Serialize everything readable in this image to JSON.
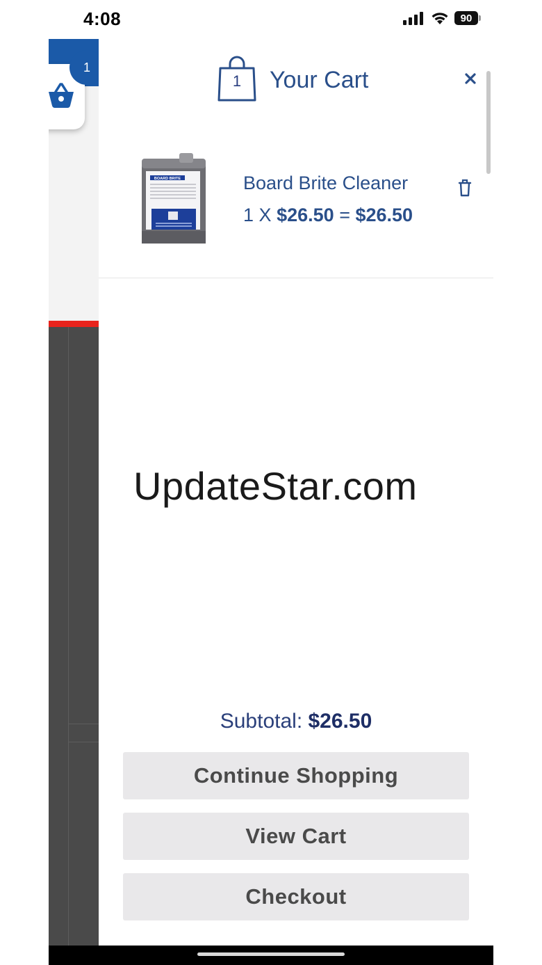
{
  "status_bar": {
    "time": "4:08",
    "battery": "90",
    "icons": [
      "cellular-signal-icon",
      "wifi-icon",
      "battery-icon"
    ]
  },
  "background_page": {
    "cart_badge": "1"
  },
  "cart": {
    "title": "Your Cart",
    "count": "1",
    "items": [
      {
        "name": "Board Brite Cleaner",
        "quantity": "1",
        "times": "X",
        "unit_price": "$26.50",
        "equals": "=",
        "line_total": "$26.50",
        "image_label": "BOARD BRITE"
      }
    ],
    "subtotal_label": "Subtotal:",
    "subtotal_value": "$26.50",
    "buttons": {
      "continue": "Continue Shopping",
      "view_cart": "View Cart",
      "checkout": "Checkout"
    }
  },
  "watermark": "UpdateStar.com",
  "colors": {
    "brand_blue": "#1b5aa8",
    "cart_text": "#2a4f8a",
    "accent_red": "#e8231c",
    "button_bg": "#e9e8ea"
  }
}
